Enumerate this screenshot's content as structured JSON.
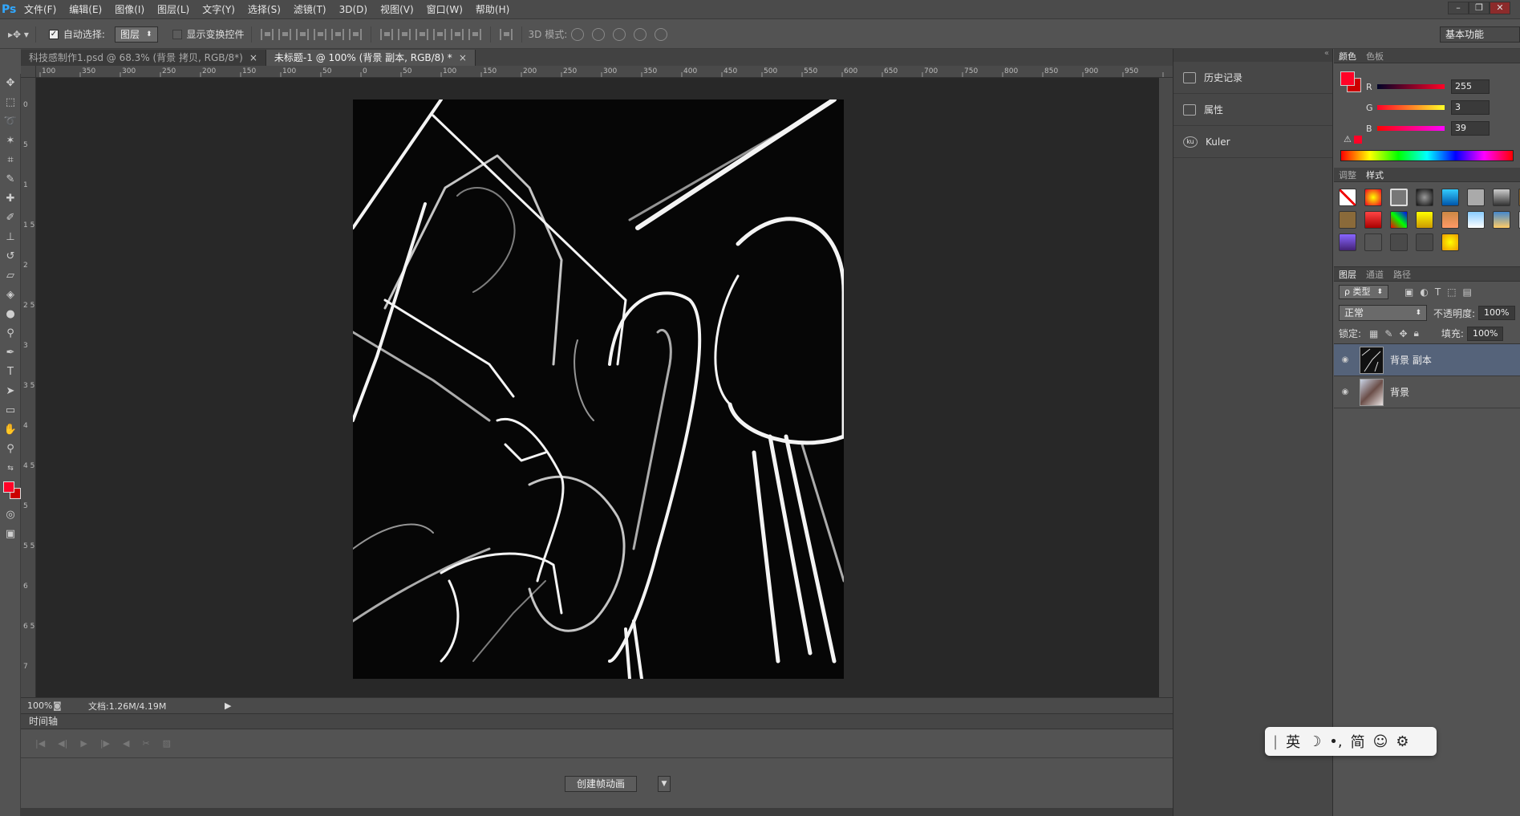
{
  "menubar": {
    "logo": "Ps",
    "items": [
      "文件(F)",
      "编辑(E)",
      "图像(I)",
      "图层(L)",
      "文字(Y)",
      "选择(S)",
      "滤镜(T)",
      "3D(D)",
      "视图(V)",
      "窗口(W)",
      "帮助(H)"
    ]
  },
  "options": {
    "auto_select_label": "自动选择:",
    "auto_select_value": "图层",
    "show_transform_label": "显示变换控件",
    "mode3d_label": "3D 模式:",
    "workspace": "基本功能"
  },
  "tabs": [
    {
      "label": "科技感制作1.psd @ 68.3% (背景 拷贝, RGB/8*)",
      "close": "×"
    },
    {
      "label": "未标题-1 @ 100% (背景 副本, RGB/8) *",
      "close": "×"
    }
  ],
  "ruler_h": [
    "100",
    "350",
    "300",
    "250",
    "200",
    "150",
    "100",
    "50",
    "0",
    "50",
    "100",
    "150",
    "200",
    "250",
    "300",
    "350",
    "400",
    "450",
    "500",
    "550",
    "600",
    "650",
    "700",
    "750",
    "800",
    "850",
    "900",
    "950"
  ],
  "ruler_v": [
    "0",
    "5",
    "1",
    "1 5",
    "2",
    "2 5",
    "3",
    "3 5",
    "4",
    "4 5",
    "5",
    "5 5",
    "6",
    "6 5",
    "7"
  ],
  "status": {
    "zoom": "100%",
    "doc": "文档:1.26M/4.19M"
  },
  "timeline": {
    "title": "时间轴",
    "create_button": "创建帧动画"
  },
  "dock": {
    "items": [
      {
        "label": "历史记录",
        "icon": "history-icon"
      },
      {
        "label": "属性",
        "icon": "properties-icon"
      },
      {
        "label": "Kuler",
        "icon": "kuler-icon"
      }
    ]
  },
  "color_panel": {
    "tabs": [
      "颜色",
      "色板"
    ],
    "r_label": "R",
    "g_label": "G",
    "b_label": "B",
    "r": "255",
    "g": "3",
    "b": "39",
    "fg": "#ff0327"
  },
  "styles_panel": {
    "tabs": [
      "调整",
      "样式"
    ]
  },
  "layers_panel": {
    "tabs": [
      "图层",
      "通道",
      "路径"
    ],
    "filter": "ρ 类型",
    "blend_mode": "正常",
    "opacity_label": "不透明度:",
    "opacity": "100%",
    "lock_label": "锁定:",
    "fill_label": "填充:",
    "fill": "100%",
    "layers": [
      {
        "name": "背景 副本",
        "selected": true
      },
      {
        "name": "背景",
        "selected": false
      }
    ]
  },
  "ime": {
    "mode": "英",
    "moon": "☽",
    "punct": "•,",
    "simp": "简",
    "emoji": "☺",
    "gear": "⚙"
  }
}
